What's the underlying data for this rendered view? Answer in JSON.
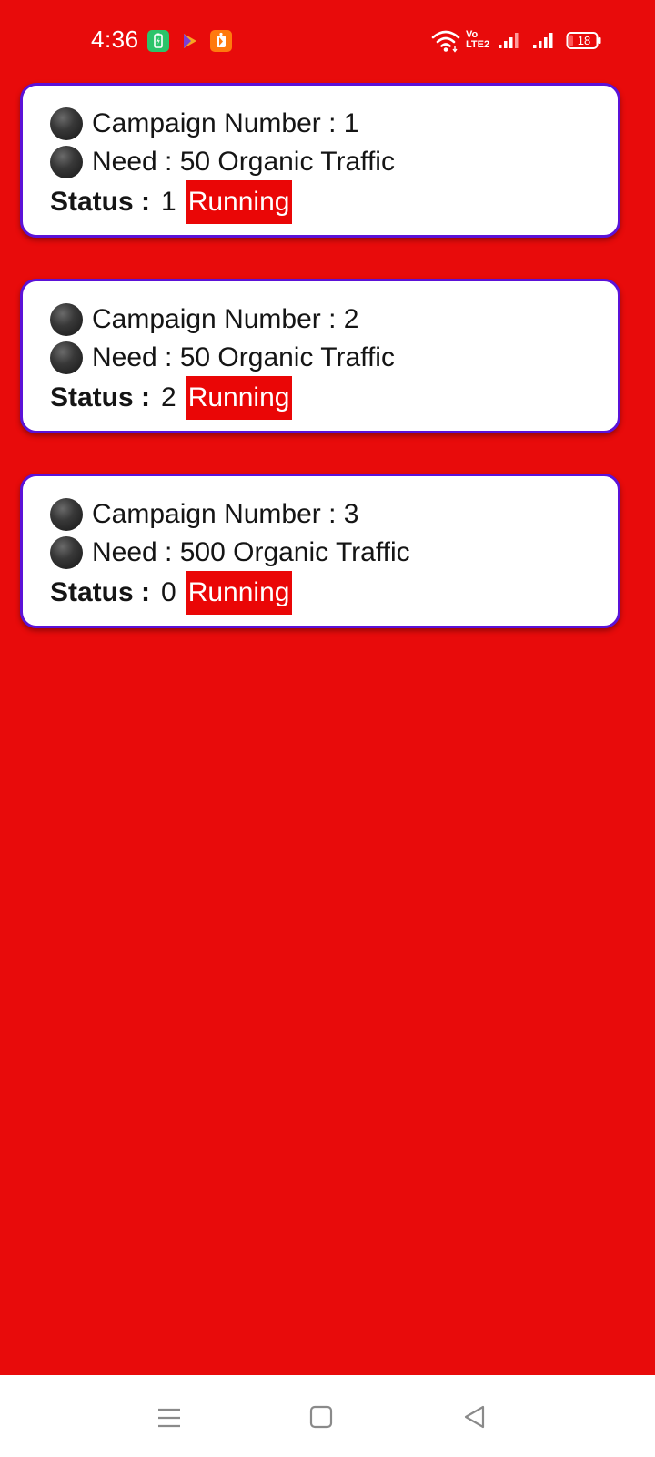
{
  "status_bar": {
    "time": "4:36",
    "battery_level": "18",
    "network_label": "Vo LTE2",
    "app_icons": [
      "battery-saver-app-icon",
      "play-app-icon",
      "orange-app-icon"
    ]
  },
  "campaigns": [
    {
      "number_text": "Campaign Number : 1",
      "need_text": "Need : 50 Organic Traffic",
      "status_label": "Status :",
      "status_count": "1",
      "status_badge": "Running"
    },
    {
      "number_text": "Campaign Number : 2",
      "need_text": "Need : 50 Organic Traffic",
      "status_label": "Status :",
      "status_count": "2",
      "status_badge": "Running"
    },
    {
      "number_text": "Campaign Number : 3",
      "need_text": "Need : 500 Organic Traffic",
      "status_label": "Status :",
      "status_count": "0",
      "status_badge": "Running"
    }
  ],
  "nav": {
    "buttons": [
      "menu-icon",
      "home-icon",
      "back-icon"
    ]
  },
  "colors": {
    "background": "#e80b0b",
    "card_border": "#5b12d8",
    "badge": "#ea0606",
    "card": "#ffffff"
  }
}
